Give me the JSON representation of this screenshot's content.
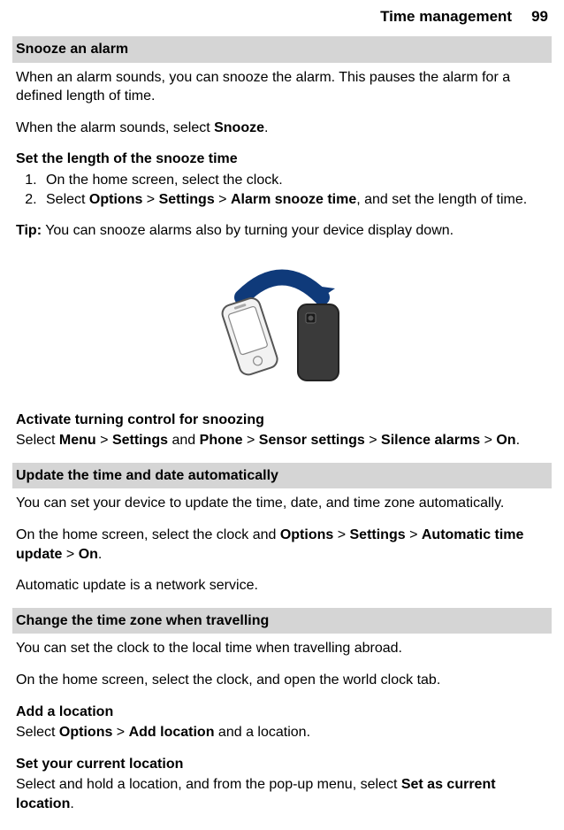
{
  "header": {
    "title": "Time management",
    "page": "99"
  },
  "sections": {
    "snooze": {
      "bar": "Snooze an alarm",
      "p1": "When an alarm sounds, you can snooze the alarm. This pauses the alarm for a defined length of time.",
      "p2_pre": "When the alarm sounds, select ",
      "p2_bold": "Snooze",
      "p2_post": ".",
      "len_heading": "Set the length of the snooze time",
      "step1": "On the home screen, select the clock.",
      "step2_pre": "Select ",
      "opt": "Options",
      "gt": " > ",
      "settings": "Settings",
      "alarm_snooze": "Alarm snooze time",
      "step2_post": ", and set the length of time.",
      "tip_label": "Tip:",
      "tip_body": " You can snooze alarms also by turning your device display down.",
      "activate_heading": "Activate turning control for snoozing",
      "activate_pre": "Select ",
      "menu": "Menu",
      "and": " and ",
      "phone": "Phone",
      "sensor": "Sensor settings",
      "silence": "Silence alarms",
      "on": "On",
      "activate_post": "."
    },
    "update": {
      "bar": "Update the time and date automatically",
      "p1": "You can set your device to update the time, date, and time zone automatically.",
      "p2_pre": "On the home screen, select the clock and ",
      "auto": "Automatic time update",
      "p2_post": ".",
      "p3": "Automatic update is a network service."
    },
    "travel": {
      "bar": "Change the time zone when travelling",
      "p1": "You can set the clock to the local time when travelling abroad.",
      "p2": "On the home screen, select the clock, and open the world clock tab.",
      "add_heading": "Add a location",
      "add_pre": "Select ",
      "add_location": "Add location",
      "add_post": " and a location.",
      "set_heading": "Set your current location",
      "set_pre": "Select and hold a location, and from the pop-up menu, select ",
      "set_current": "Set as current location",
      "set_post": "."
    }
  }
}
